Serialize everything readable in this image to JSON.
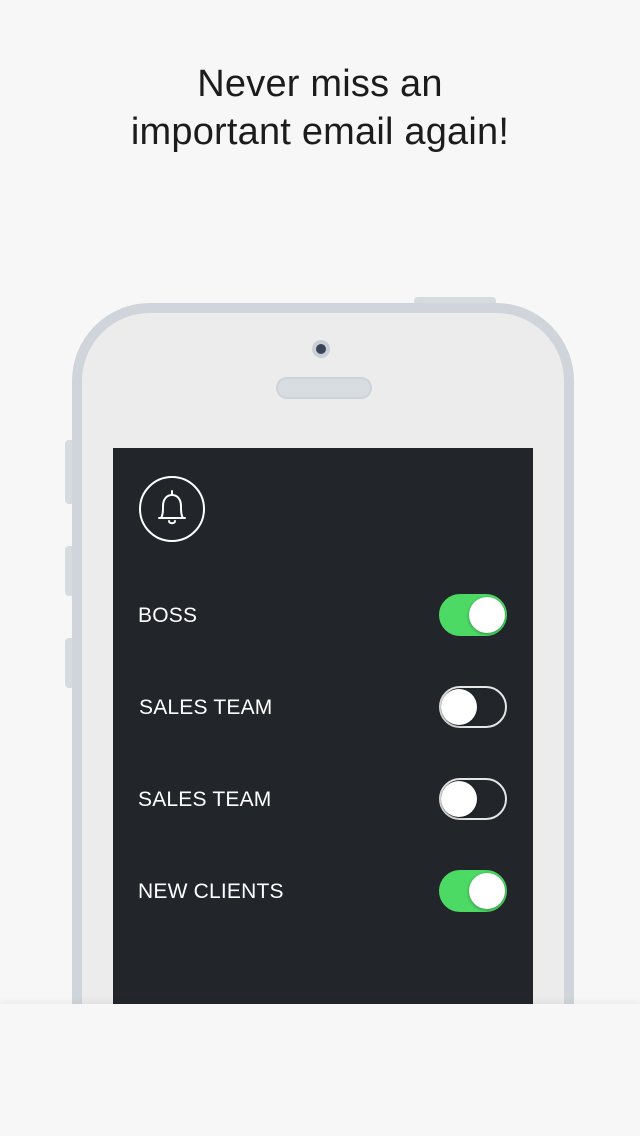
{
  "headline": {
    "line1": "Never miss an",
    "line2": "important email again!"
  },
  "screen": {
    "header_icon": "bell-icon",
    "items": [
      {
        "label": "BOSS",
        "enabled": true
      },
      {
        "label": "SALES TEAM",
        "enabled": false
      },
      {
        "label": "SALES TEAM",
        "enabled": false
      },
      {
        "label": "NEW CLIENTS",
        "enabled": true
      }
    ]
  },
  "colors": {
    "background": "#f7f7f7",
    "screen_bg": "#22262b",
    "toggle_on": "#4cd964",
    "phone_frame": "#cfd5da",
    "phone_body": "#ececec"
  }
}
